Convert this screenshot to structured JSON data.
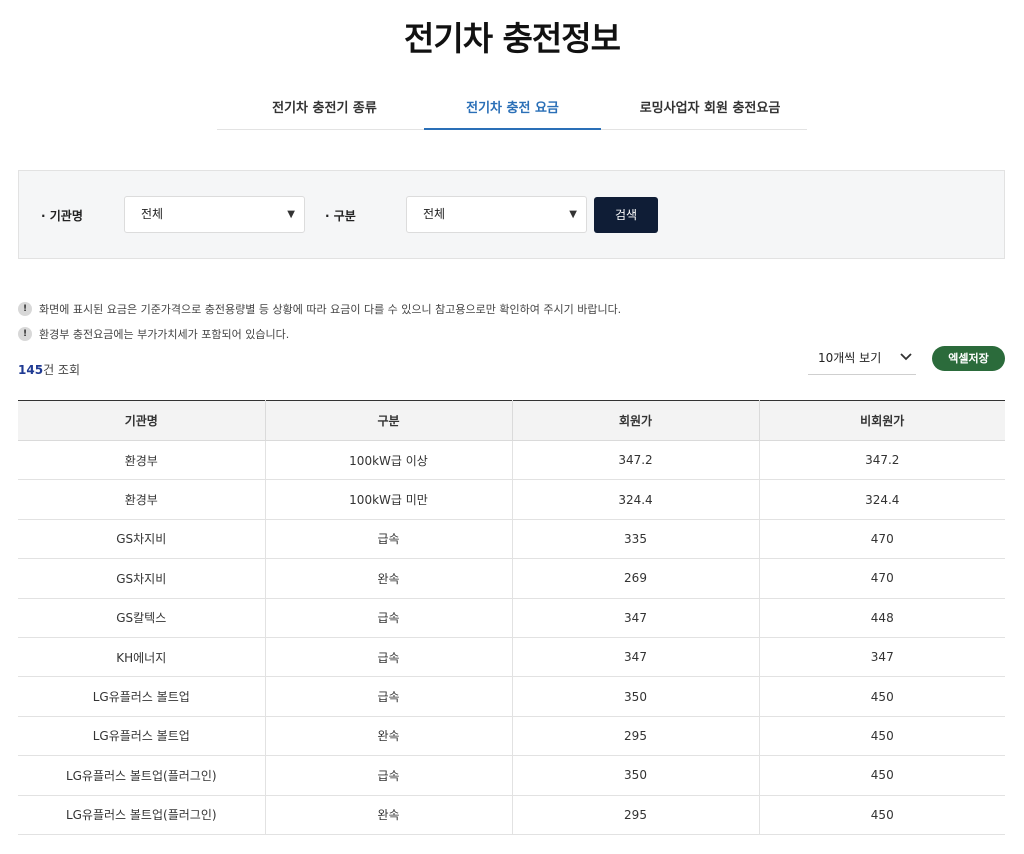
{
  "page": {
    "title": "전기차 충전정보"
  },
  "tabs": [
    {
      "label": "전기차 충전기 종류",
      "active": false
    },
    {
      "label": "전기차 충전 요금",
      "active": true
    },
    {
      "label": "로밍사업자 회원 충전요금",
      "active": false
    }
  ],
  "filter": {
    "agency_label": "· 기관명",
    "agency_value": "전체",
    "type_label": "· 구분",
    "type_value": "전체",
    "search_label": "검색"
  },
  "notices": [
    "화면에 표시된 요금은 기준가격으로 충전용량별 등 상황에 따라 요금이 다를 수 있으니 참고용으로만 확인하여 주시기 바랍니다.",
    "환경부 충전요금에는 부가가치세가 포함되어 있습니다."
  ],
  "results": {
    "count": "145",
    "count_suffix": "건 조회"
  },
  "controls": {
    "page_size": "10개씩 보기",
    "excel_label": "엑셀저장"
  },
  "table": {
    "headers": [
      "기관명",
      "구분",
      "회원가",
      "비회원가"
    ],
    "rows": [
      [
        "환경부",
        "100kW급 이상",
        "347.2",
        "347.2"
      ],
      [
        "환경부",
        "100kW급 미만",
        "324.4",
        "324.4"
      ],
      [
        "GS차지비",
        "급속",
        "335",
        "470"
      ],
      [
        "GS차지비",
        "완속",
        "269",
        "470"
      ],
      [
        "GS칼텍스",
        "급속",
        "347",
        "448"
      ],
      [
        "KH에너지",
        "급속",
        "347",
        "347"
      ],
      [
        "LG유플러스 볼트업",
        "급속",
        "350",
        "450"
      ],
      [
        "LG유플러스 볼트업",
        "완속",
        "295",
        "450"
      ],
      [
        "LG유플러스 볼트업(플러그인)",
        "급속",
        "350",
        "450"
      ],
      [
        "LG유플러스 볼트업(플러그인)",
        "완속",
        "295",
        "450"
      ]
    ]
  }
}
